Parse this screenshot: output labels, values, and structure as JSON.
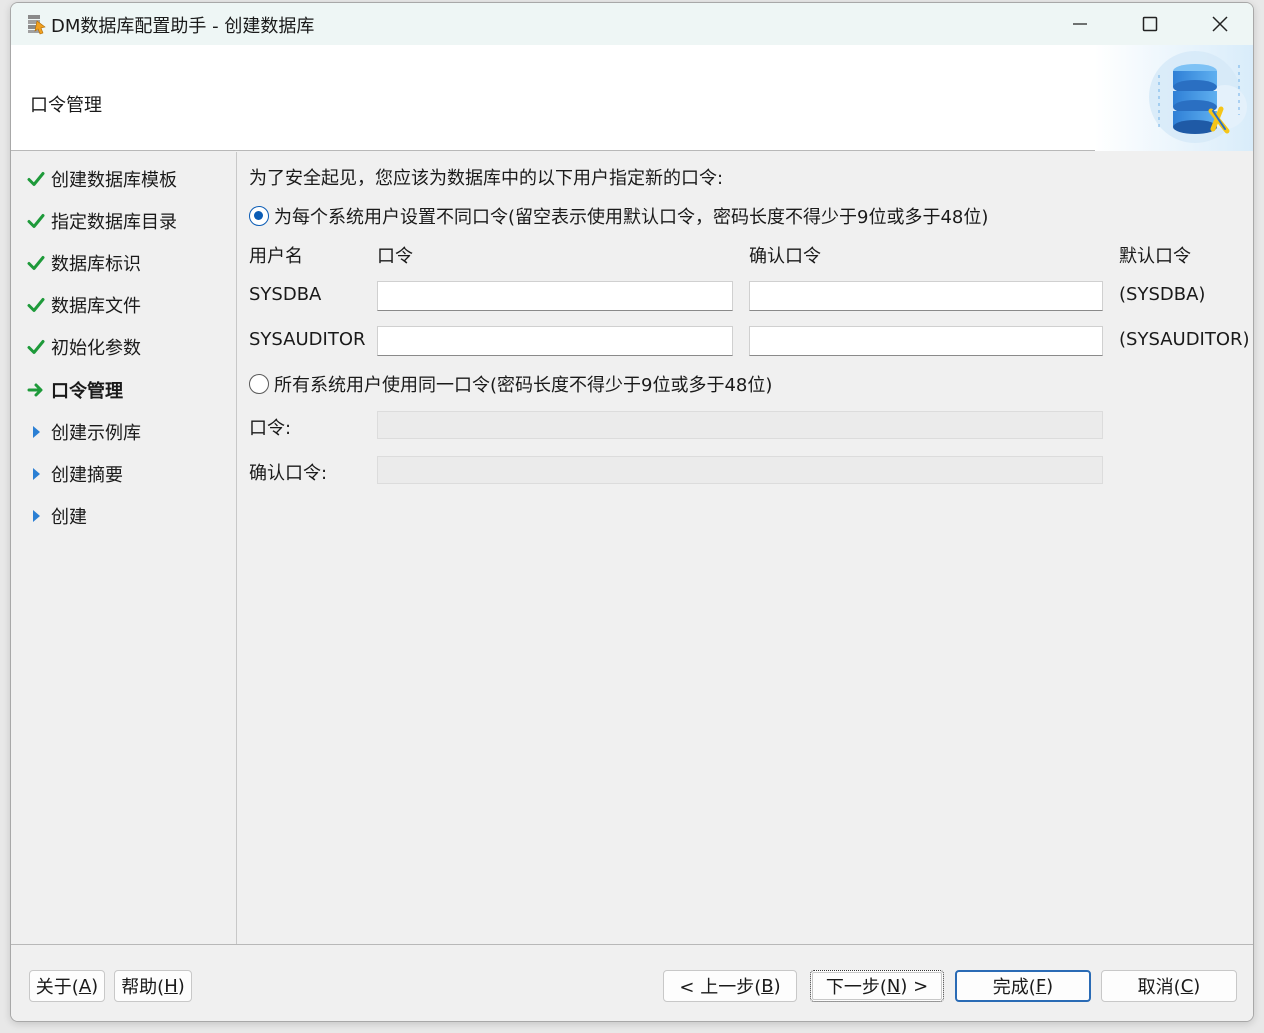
{
  "window": {
    "title": "DM数据库配置助手 - 创建数据库",
    "icon": "database-wizard-icon"
  },
  "banner": {
    "title": "口令管理",
    "art": "database-server-icon"
  },
  "nav": {
    "items": [
      {
        "label": "创建数据库模板",
        "state": "done"
      },
      {
        "label": "指定数据库目录",
        "state": "done"
      },
      {
        "label": "数据库标识",
        "state": "done"
      },
      {
        "label": "数据库文件",
        "state": "done"
      },
      {
        "label": "初始化参数",
        "state": "done"
      },
      {
        "label": "口令管理",
        "state": "current"
      },
      {
        "label": "创建示例库",
        "state": "pending"
      },
      {
        "label": "创建摘要",
        "state": "pending"
      },
      {
        "label": "创建",
        "state": "pending"
      }
    ]
  },
  "content": {
    "intro": "为了安全起见，您应该为数据库中的以下用户指定新的口令:",
    "option_individual": "为每个系统用户设置不同口令(留空表示使用默认口令，密码长度不得少于9位或多于48位)",
    "headers": {
      "user": "用户名",
      "password": "口令",
      "confirm": "确认口令",
      "default": "默认口令"
    },
    "rows": [
      {
        "user": "SYSDBA",
        "password": "",
        "confirm": "",
        "default": "(SYSDBA)"
      },
      {
        "user": "SYSAUDITOR",
        "password": "",
        "confirm": "",
        "default": "(SYSAUDITOR)"
      }
    ],
    "option_shared": "所有系统用户使用同一口令(密码长度不得少于9位或多于48位)",
    "shared_password_label": "口令:",
    "shared_confirm_label": "确认口令:",
    "shared_password_value": "",
    "shared_confirm_value": ""
  },
  "footer": {
    "about_label": "关于(",
    "about_key": "A",
    "help_label": "帮助(",
    "help_key": "H",
    "back_label": "< 上一步(",
    "back_key": "B",
    "next_label": "下一步(",
    "next_key": "N",
    "next_suffix": ") >",
    "finish_label": "完成(",
    "finish_key": "F",
    "cancel_label": "取消(",
    "cancel_key": "C",
    "close_paren": ")"
  },
  "colors": {
    "check": "#1e9a3a",
    "arrow_current": "#1e9a3a",
    "arrow_pending": "#2a7fd4",
    "accent": "#0b5cb5"
  }
}
